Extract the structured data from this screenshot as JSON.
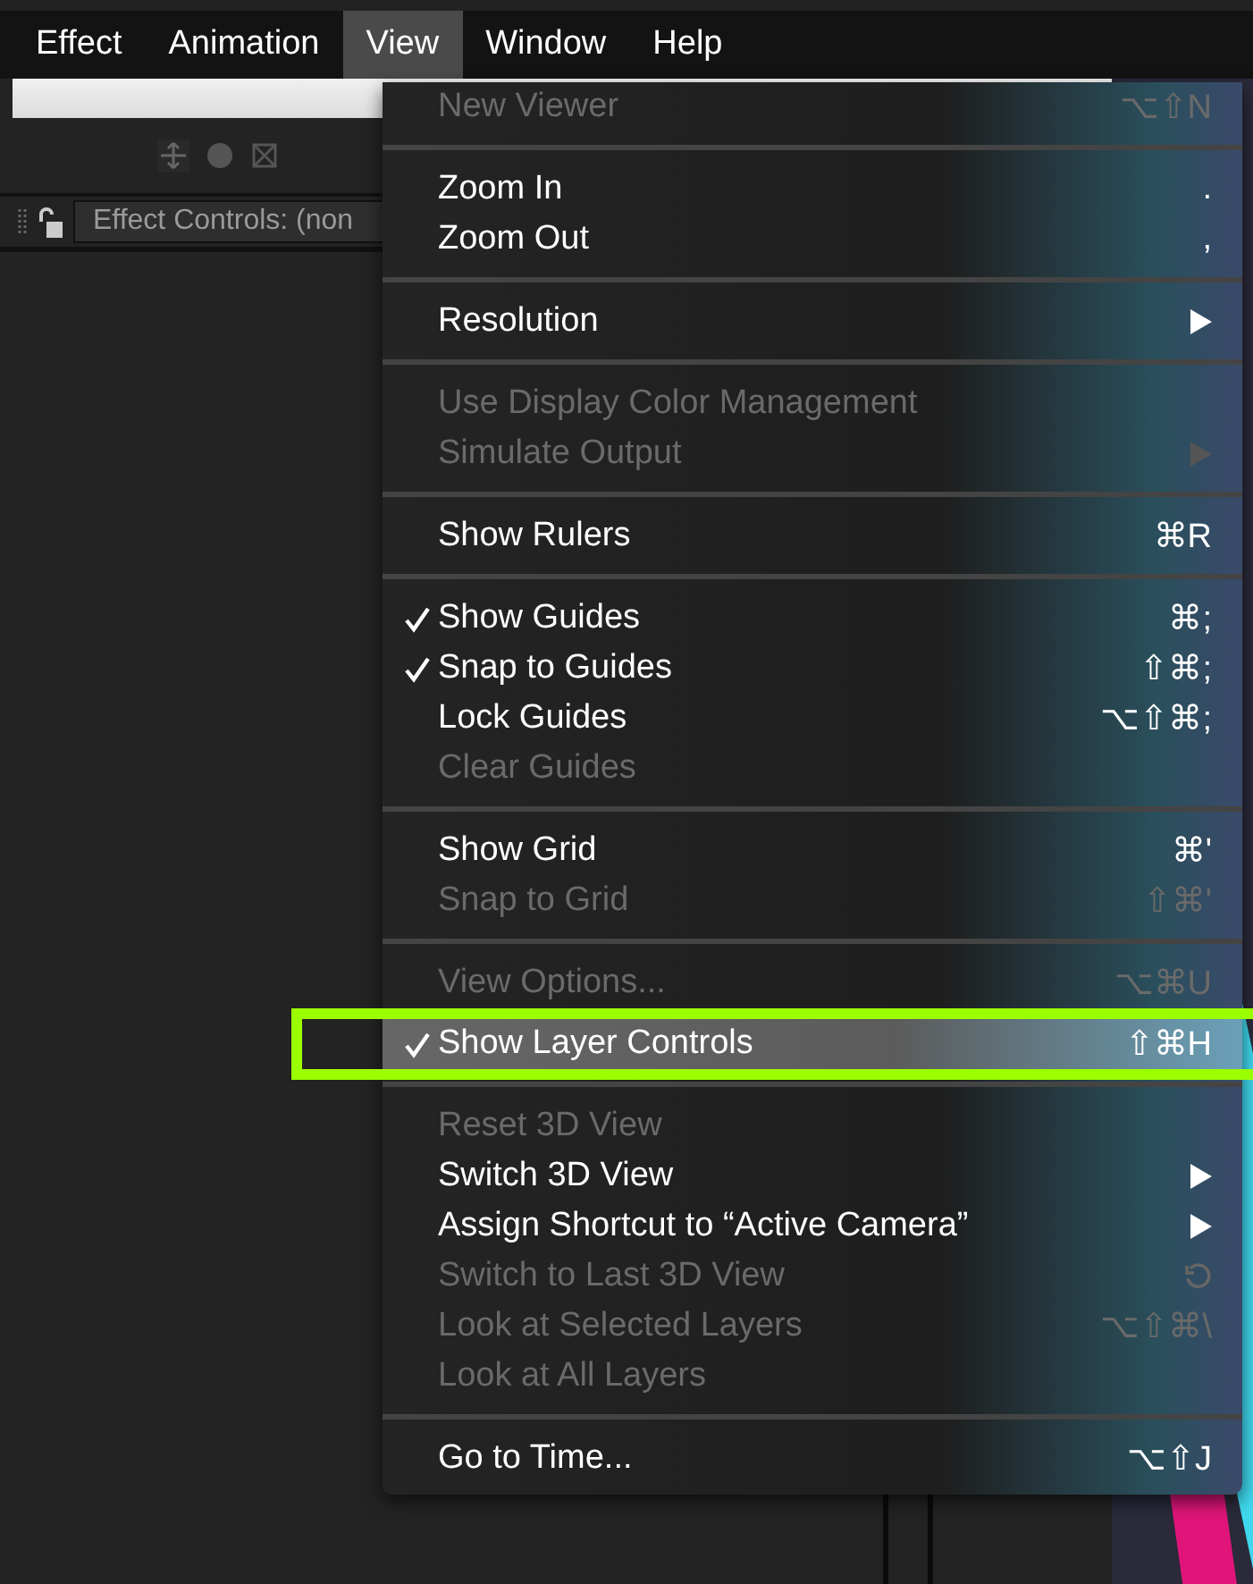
{
  "menubar": [
    {
      "label": "Effect",
      "selected": false
    },
    {
      "label": "Animation",
      "selected": false
    },
    {
      "label": "View",
      "selected": true
    },
    {
      "label": "Window",
      "selected": false
    },
    {
      "label": "Help",
      "selected": false
    }
  ],
  "panel": {
    "tab_title": "Effect Controls: (non"
  },
  "menu": [
    {
      "kind": "item",
      "label": "New Viewer",
      "shortcut": "⌥⇧N",
      "disabled": true,
      "checked": false,
      "selected": false
    },
    {
      "kind": "separator"
    },
    {
      "kind": "item",
      "label": "Zoom In",
      "shortcut": ".",
      "disabled": false,
      "checked": false,
      "selected": false
    },
    {
      "kind": "item",
      "label": "Zoom Out",
      "shortcut": ",",
      "disabled": false,
      "checked": false,
      "selected": false
    },
    {
      "kind": "separator"
    },
    {
      "kind": "submenu",
      "label": "Resolution",
      "disabled": false,
      "checked": false,
      "selected": false
    },
    {
      "kind": "separator"
    },
    {
      "kind": "item",
      "label": "Use Display Color Management",
      "disabled": true,
      "checked": false,
      "selected": false
    },
    {
      "kind": "submenu",
      "label": "Simulate Output",
      "disabled": true,
      "checked": false,
      "selected": false
    },
    {
      "kind": "separator"
    },
    {
      "kind": "item",
      "label": "Show Rulers",
      "shortcut": "⌘R",
      "disabled": false,
      "checked": false,
      "selected": false
    },
    {
      "kind": "separator"
    },
    {
      "kind": "item",
      "label": "Show Guides",
      "shortcut": "⌘;",
      "disabled": false,
      "checked": true,
      "selected": false
    },
    {
      "kind": "item",
      "label": "Snap to Guides",
      "shortcut": "⇧⌘;",
      "disabled": false,
      "checked": true,
      "selected": false
    },
    {
      "kind": "item",
      "label": "Lock Guides",
      "shortcut": "⌥⇧⌘;",
      "disabled": false,
      "checked": false,
      "selected": false
    },
    {
      "kind": "item",
      "label": "Clear Guides",
      "disabled": true,
      "checked": false,
      "selected": false
    },
    {
      "kind": "separator"
    },
    {
      "kind": "item",
      "label": "Show Grid",
      "shortcut": "⌘'",
      "disabled": false,
      "checked": false,
      "selected": false
    },
    {
      "kind": "item",
      "label": "Snap to Grid",
      "shortcut": "⇧⌘'",
      "disabled": true,
      "checked": false,
      "selected": false
    },
    {
      "kind": "separator"
    },
    {
      "kind": "item",
      "label": "View Options...",
      "shortcut": "⌥⌘U",
      "disabled": true,
      "checked": false,
      "selected": false
    },
    {
      "kind": "item",
      "label": "Show Layer Controls",
      "shortcut": "⇧⌘H",
      "disabled": false,
      "checked": true,
      "selected": true
    },
    {
      "kind": "separator"
    },
    {
      "kind": "item",
      "label": "Reset 3D View",
      "disabled": true,
      "checked": false,
      "selected": false
    },
    {
      "kind": "submenu",
      "label": "Switch 3D View",
      "disabled": false,
      "checked": false,
      "selected": false
    },
    {
      "kind": "submenu",
      "label": "Assign Shortcut to “Active Camera”",
      "disabled": false,
      "checked": false,
      "selected": false
    },
    {
      "kind": "icon_item",
      "label": "Switch to Last 3D View",
      "disabled": true,
      "checked": false,
      "selected": false
    },
    {
      "kind": "item",
      "label": "Look at Selected Layers",
      "shortcut": "⌥⇧⌘\\",
      "disabled": true,
      "checked": false,
      "selected": false
    },
    {
      "kind": "item",
      "label": "Look at All Layers",
      "disabled": true,
      "checked": false,
      "selected": false
    },
    {
      "kind": "separator"
    },
    {
      "kind": "item",
      "label": "Go to Time...",
      "shortcut": "⌥⇧J",
      "disabled": false,
      "checked": false,
      "selected": false
    }
  ]
}
